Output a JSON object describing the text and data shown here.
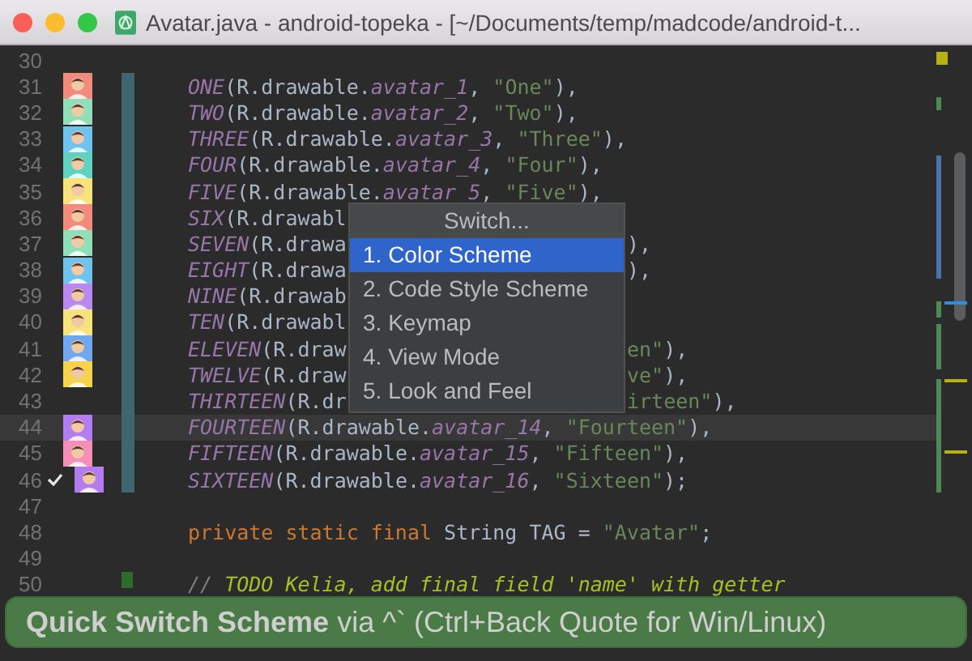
{
  "window": {
    "title": "Avatar.java - android-topeka - [~/Documents/temp/madcode/android-t..."
  },
  "editor": {
    "lines": [
      {
        "num": "30",
        "checked": false,
        "current": false
      },
      {
        "num": "31",
        "checked": false,
        "current": false,
        "change": {
          "color": "#3f6670"
        },
        "avatar": {
          "color": "#f28b7b"
        },
        "segments": [
          {
            "kind": "const",
            "text": "ONE"
          },
          {
            "kind": "plain",
            "text": "(R.drawable."
          },
          {
            "kind": "field",
            "text": "avatar_1"
          },
          {
            "kind": "plain",
            "text": ", "
          },
          {
            "kind": "string",
            "text": "\"One\""
          },
          {
            "kind": "plain",
            "text": "),"
          }
        ]
      },
      {
        "num": "32",
        "checked": false,
        "current": false,
        "change": {
          "color": "#3f6670"
        },
        "avatar": {
          "color": "#8fe0b8"
        },
        "segments": [
          {
            "kind": "const",
            "text": "TWO"
          },
          {
            "kind": "plain",
            "text": "(R.drawable."
          },
          {
            "kind": "field",
            "text": "avatar_2"
          },
          {
            "kind": "plain",
            "text": ", "
          },
          {
            "kind": "string",
            "text": "\"Two\""
          },
          {
            "kind": "plain",
            "text": "),"
          }
        ]
      },
      {
        "num": "33",
        "checked": false,
        "current": false,
        "change": {
          "color": "#3f6670"
        },
        "avatar": {
          "color": "#6fc3ef"
        },
        "segments": [
          {
            "kind": "const",
            "text": "THREE"
          },
          {
            "kind": "plain",
            "text": "(R.drawable."
          },
          {
            "kind": "field",
            "text": "avatar_3"
          },
          {
            "kind": "plain",
            "text": ", "
          },
          {
            "kind": "string",
            "text": "\"Three\""
          },
          {
            "kind": "plain",
            "text": "),"
          }
        ]
      },
      {
        "num": "34",
        "checked": false,
        "current": false,
        "change": {
          "color": "#3f6670"
        },
        "avatar": {
          "color": "#5fd3c0"
        },
        "segments": [
          {
            "kind": "const",
            "text": "FOUR"
          },
          {
            "kind": "plain",
            "text": "(R.drawable."
          },
          {
            "kind": "field",
            "text": "avatar_4"
          },
          {
            "kind": "plain",
            "text": ", "
          },
          {
            "kind": "string",
            "text": "\"Four\""
          },
          {
            "kind": "plain",
            "text": "),"
          }
        ]
      },
      {
        "num": "35",
        "checked": false,
        "current": false,
        "change": {
          "color": "#3f6670"
        },
        "avatar": {
          "color": "#f6e37a"
        },
        "segments": [
          {
            "kind": "const",
            "text": "FIVE"
          },
          {
            "kind": "plain",
            "text": "(R.drawable."
          },
          {
            "kind": "field",
            "text": "avatar_5"
          },
          {
            "kind": "plain",
            "text": ", "
          },
          {
            "kind": "string",
            "text": "\"Five\""
          },
          {
            "kind": "plain",
            "text": "),"
          }
        ]
      },
      {
        "num": "36",
        "checked": false,
        "current": false,
        "change": {
          "color": "#3f6670"
        },
        "avatar": {
          "color": "#f28b7b"
        },
        "segments": [
          {
            "kind": "const",
            "text": "SIX"
          },
          {
            "kind": "plain",
            "text": "(R.drawabl"
          }
        ]
      },
      {
        "num": "37",
        "checked": false,
        "current": false,
        "change": {
          "color": "#3f6670"
        },
        "avatar": {
          "color": "#8fe0b8"
        },
        "segments": [
          {
            "kind": "const",
            "text": "SEVEN"
          },
          {
            "kind": "plain",
            "text": "(R.drawa"
          }
        ],
        "tail": [
          {
            "kind": "plain",
            "text": "),"
          }
        ]
      },
      {
        "num": "38",
        "checked": false,
        "current": false,
        "change": {
          "color": "#3f6670"
        },
        "avatar": {
          "color": "#6fc3ef"
        },
        "segments": [
          {
            "kind": "const",
            "text": "EIGHT"
          },
          {
            "kind": "plain",
            "text": "(R.drawa"
          }
        ],
        "tail": [
          {
            "kind": "plain",
            "text": "),"
          }
        ]
      },
      {
        "num": "39",
        "checked": false,
        "current": false,
        "change": {
          "color": "#3f6670"
        },
        "avatar": {
          "color": "#b889f0"
        },
        "segments": [
          {
            "kind": "const",
            "text": "NINE"
          },
          {
            "kind": "plain",
            "text": "(R.drawab"
          }
        ]
      },
      {
        "num": "40",
        "checked": false,
        "current": false,
        "change": {
          "color": "#3f6670"
        },
        "avatar": {
          "color": "#f6e37a"
        },
        "segments": [
          {
            "kind": "const",
            "text": "TEN"
          },
          {
            "kind": "plain",
            "text": "(R.drawabl"
          }
        ]
      },
      {
        "num": "41",
        "checked": false,
        "current": false,
        "change": {
          "color": "#3f6670"
        },
        "avatar": {
          "color": "#6fa8ef"
        },
        "segments": [
          {
            "kind": "const",
            "text": "ELEVEN"
          },
          {
            "kind": "plain",
            "text": "(R.draw"
          }
        ],
        "tail": [
          {
            "kind": "string",
            "text": "en\""
          },
          {
            "kind": "plain",
            "text": "),"
          }
        ]
      },
      {
        "num": "42",
        "checked": false,
        "current": false,
        "change": {
          "color": "#3f6670"
        },
        "avatar": {
          "color": "#f6d34a"
        },
        "segments": [
          {
            "kind": "const",
            "text": "TWELVE"
          },
          {
            "kind": "plain",
            "text": "(R.draw"
          }
        ],
        "tail": [
          {
            "kind": "string",
            "text": "ve\""
          },
          {
            "kind": "plain",
            "text": "),"
          }
        ]
      },
      {
        "num": "43",
        "checked": false,
        "current": false,
        "change": {
          "color": "#3f6670"
        },
        "segments": [
          {
            "kind": "const",
            "text": "THIRTEEN"
          },
          {
            "kind": "plain",
            "text": "(R.dr"
          }
        ],
        "tail": [
          {
            "kind": "string",
            "text": "irteen\""
          },
          {
            "kind": "plain",
            "text": "),"
          }
        ]
      },
      {
        "num": "44",
        "checked": false,
        "current": true,
        "change": {
          "color": "#3f6670"
        },
        "avatar": {
          "color": "#b37cf0"
        },
        "segments": [
          {
            "kind": "const",
            "text": "FOURTEEN"
          },
          {
            "kind": "plain",
            "text": "(R.drawable."
          },
          {
            "kind": "field",
            "text": "avatar_14"
          },
          {
            "kind": "plain",
            "text": ", "
          },
          {
            "kind": "string",
            "text": "\"Fourteen\""
          },
          {
            "kind": "plain",
            "text": "),"
          }
        ]
      },
      {
        "num": "45",
        "checked": false,
        "current": false,
        "change": {
          "color": "#3f6670"
        },
        "avatar": {
          "color": "#f58fb8"
        },
        "segments": [
          {
            "kind": "const",
            "text": "FIFTEEN"
          },
          {
            "kind": "plain",
            "text": "(R.drawable."
          },
          {
            "kind": "field",
            "text": "avatar_15"
          },
          {
            "kind": "plain",
            "text": ", "
          },
          {
            "kind": "string",
            "text": "\"Fifteen\""
          },
          {
            "kind": "plain",
            "text": "),"
          }
        ]
      },
      {
        "num": "46",
        "checked": true,
        "current": false,
        "change": {
          "color": "#3f6670"
        },
        "avatar": {
          "color": "#b37cf0"
        },
        "segments": [
          {
            "kind": "const",
            "text": "SIXTEEN"
          },
          {
            "kind": "plain",
            "text": "(R.drawable."
          },
          {
            "kind": "field",
            "text": "avatar_16"
          },
          {
            "kind": "plain",
            "text": ", "
          },
          {
            "kind": "string",
            "text": "\"Sixteen\""
          },
          {
            "kind": "plain",
            "text": ");"
          }
        ]
      },
      {
        "num": "47",
        "checked": false,
        "current": false
      },
      {
        "num": "48",
        "checked": false,
        "current": false,
        "segments": [
          {
            "kind": "keyword",
            "text": "private static final"
          },
          {
            "kind": "plain",
            "text": " String TAG = "
          },
          {
            "kind": "string",
            "text": "\"Avatar\""
          },
          {
            "kind": "plain",
            "text": ";"
          }
        ]
      },
      {
        "num": "49",
        "checked": false,
        "current": false
      },
      {
        "num": "50",
        "checked": false,
        "current": false,
        "change": {
          "color": "#2f6b2a"
        },
        "segments": [
          {
            "kind": "comment",
            "text": "// "
          },
          {
            "kind": "todo",
            "text": "TODO Kelia, add final field 'name' with getter"
          }
        ]
      }
    ]
  },
  "popup": {
    "title": "Switch...",
    "items": [
      {
        "label": "1. Color Scheme",
        "selected": true
      },
      {
        "label": "2. Code Style Scheme",
        "selected": false
      },
      {
        "label": "3. Keymap",
        "selected": false
      },
      {
        "label": "4. View Mode",
        "selected": false
      },
      {
        "label": "5. Look and Feel",
        "selected": false
      }
    ]
  },
  "banner": {
    "text": "**Quick Switch Scheme** via ^` (Ctrl+Back Quote for Win/Linux)"
  }
}
